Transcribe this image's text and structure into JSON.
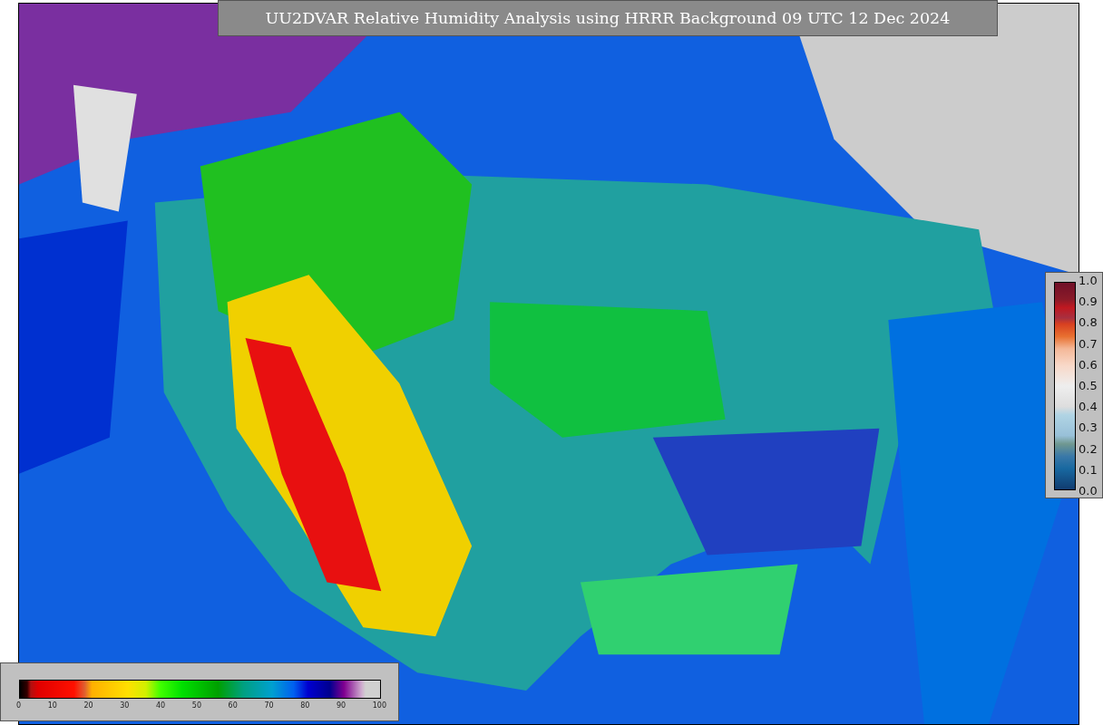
{
  "title": "UU2DVAR Relative Humidity Analysis using HRRR Background 09 UTC 12 Dec 2024",
  "station_legend": {
    "ticks": [
      "1.0",
      "0.9",
      "0.8",
      "0.7",
      "0.6",
      "0.5",
      "0.4",
      "0.3",
      "0.2",
      "0.1",
      "0.0"
    ]
  },
  "humidity_legend": {
    "ticks": [
      "0",
      "10",
      "20",
      "30",
      "40",
      "50",
      "60",
      "70",
      "80",
      "90",
      "100"
    ]
  }
}
